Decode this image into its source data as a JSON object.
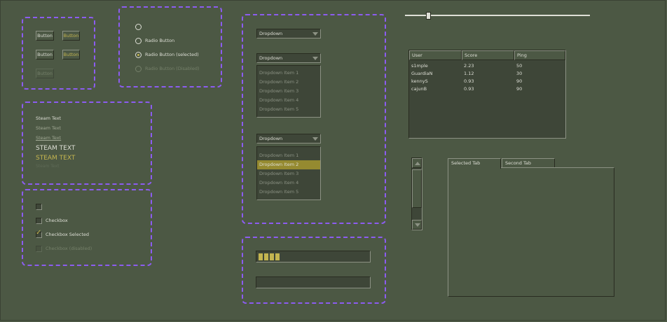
{
  "buttons": {
    "b1": "Button",
    "b2": "Button",
    "b3": "Button",
    "b4": "Button",
    "b5": "Button"
  },
  "radios": {
    "r1": "",
    "r2": "Radio Button",
    "r3": "Radio Button (selected)",
    "r4": "Radio Button (Disabled)"
  },
  "steam_text": {
    "t1": "Steam Text",
    "t2": "Steam Text",
    "t3": "Steam Text",
    "t4": "STEAM TEXT",
    "t5": "STEAM TEXT",
    "t6": "Steam Text"
  },
  "checkboxes": {
    "c1": "",
    "c2": "Checkbox",
    "c3": "Checkbox Selected",
    "c4": "Checkbox (disabled)"
  },
  "dropdowns": {
    "d1": "Dropdown",
    "d2": "Dropdown",
    "d2_items": [
      "Dropdown Item 1",
      "Dropdown Item 2",
      "Dropdown Item 3",
      "Dropdown Item 4",
      "Dropdown Item 5"
    ],
    "d3": "Dropdown",
    "d3_items": [
      "Dropdown Item 1",
      "Dropdown Item 2",
      "Dropdown Item 3",
      "Dropdown Item 4",
      "Dropdown Item 5"
    ],
    "d3_selected_index": 1
  },
  "progress": {
    "bar1_segments_filled": 4,
    "bar2_segments_filled": 0
  },
  "slider": {
    "value_fraction": 0.12
  },
  "table": {
    "headers": [
      "User",
      "Score",
      "Ping"
    ],
    "rows": [
      [
        "s1mple",
        "2.23",
        "50"
      ],
      [
        "GuardiaN",
        "1.12",
        "30"
      ],
      [
        "kennyS",
        "0.93",
        "90"
      ],
      [
        "cajunB",
        "0.93",
        "90"
      ]
    ]
  },
  "tabs": {
    "tab1": "Selected Tab",
    "tab2": "Second Tab"
  },
  "colors": {
    "accent": "#c4b550",
    "background": "#4c5844",
    "group_border": "#8c5cf0",
    "selection": "#958a30"
  }
}
